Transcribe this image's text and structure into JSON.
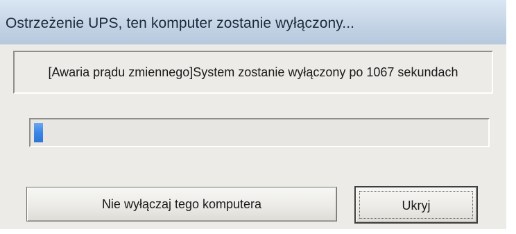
{
  "window": {
    "title": "Ostrzeżenie UPS, ten komputer zostanie wyłączony..."
  },
  "message": {
    "text": "[Awaria prądu zmiennego]System zostanie wyłączony po 1067 sekundach"
  },
  "progress": {
    "fraction": 0.02,
    "color": "#3a86e6"
  },
  "buttons": {
    "cancel_shutdown_label": "Nie wyłączaj tego komputera",
    "hide_label": "Ukryj"
  }
}
